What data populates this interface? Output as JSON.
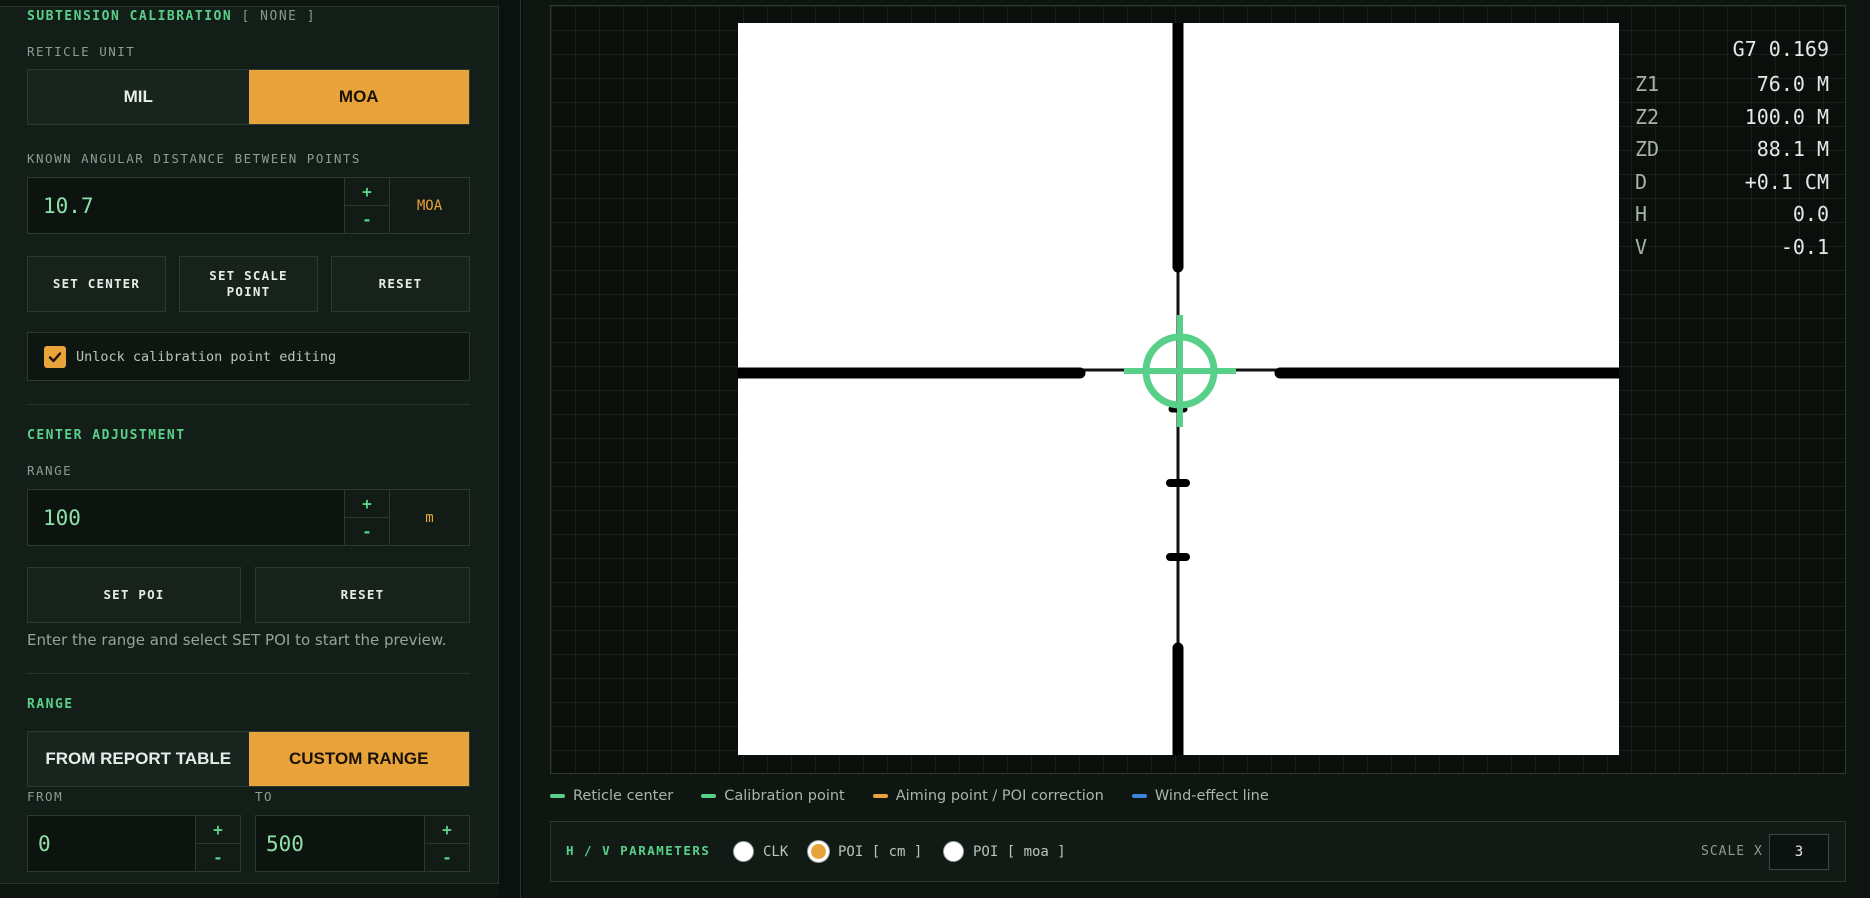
{
  "calibration": {
    "title": "SUBTENSION CALIBRATION",
    "status": "[ NONE ]",
    "reticle_unit_label": "RETICLE UNIT",
    "unit_options": [
      "MIL",
      "MOA"
    ],
    "unit_selected": "MOA",
    "distance_label": "KNOWN ANGULAR DISTANCE BETWEEN POINTS",
    "distance_value": "10.7",
    "distance_unit": "MOA",
    "plus": "+",
    "minus": "-",
    "set_center": "SET CENTER",
    "set_scale_point": "SET SCALE POINT",
    "reset": "RESET",
    "unlock_label": "Unlock calibration point editing",
    "unlock_checked": true
  },
  "center_adjustment": {
    "title": "CENTER ADJUSTMENT",
    "range_label": "RANGE",
    "range_value": "100",
    "range_unit": "m",
    "set_poi": "SET POI",
    "reset": "RESET",
    "hint": "Enter the range and select SET POI to start the preview."
  },
  "range": {
    "title": "RANGE",
    "options": [
      "FROM REPORT TABLE",
      "CUSTOM RANGE"
    ],
    "selected": "CUSTOM RANGE",
    "from_label": "FROM",
    "to_label": "TO",
    "from_value": "0",
    "to_value": "500"
  },
  "readouts": {
    "header": "G7 0.169",
    "rows": [
      {
        "k": "Z1",
        "v": "76.0 M"
      },
      {
        "k": "Z2",
        "v": "100.0 M"
      },
      {
        "k": "ZD",
        "v": "88.1 M"
      },
      {
        "k": "D",
        "v": "+0.1 CM"
      },
      {
        "k": "H",
        "v": "0.0"
      },
      {
        "k": "V",
        "v": "-0.1"
      }
    ]
  },
  "legend": [
    {
      "label": "Reticle center",
      "color": "#59d089"
    },
    {
      "label": "Calibration point",
      "color": "#59d089"
    },
    {
      "label": "Aiming point / POI correction",
      "color": "#e8a33a"
    },
    {
      "label": "Wind-effect line",
      "color": "#3d86e0"
    }
  ],
  "params": {
    "title": "H / V PARAMETERS",
    "options": [
      "CLK",
      "POI [ cm ]",
      "POI [ moa ]"
    ],
    "selected": "POI [ cm ]",
    "scale_label": "SCALE X",
    "scale_value": "3"
  },
  "colors": {
    "accent": "#e8a33a",
    "green": "#59d089",
    "blue": "#3d86e0"
  }
}
